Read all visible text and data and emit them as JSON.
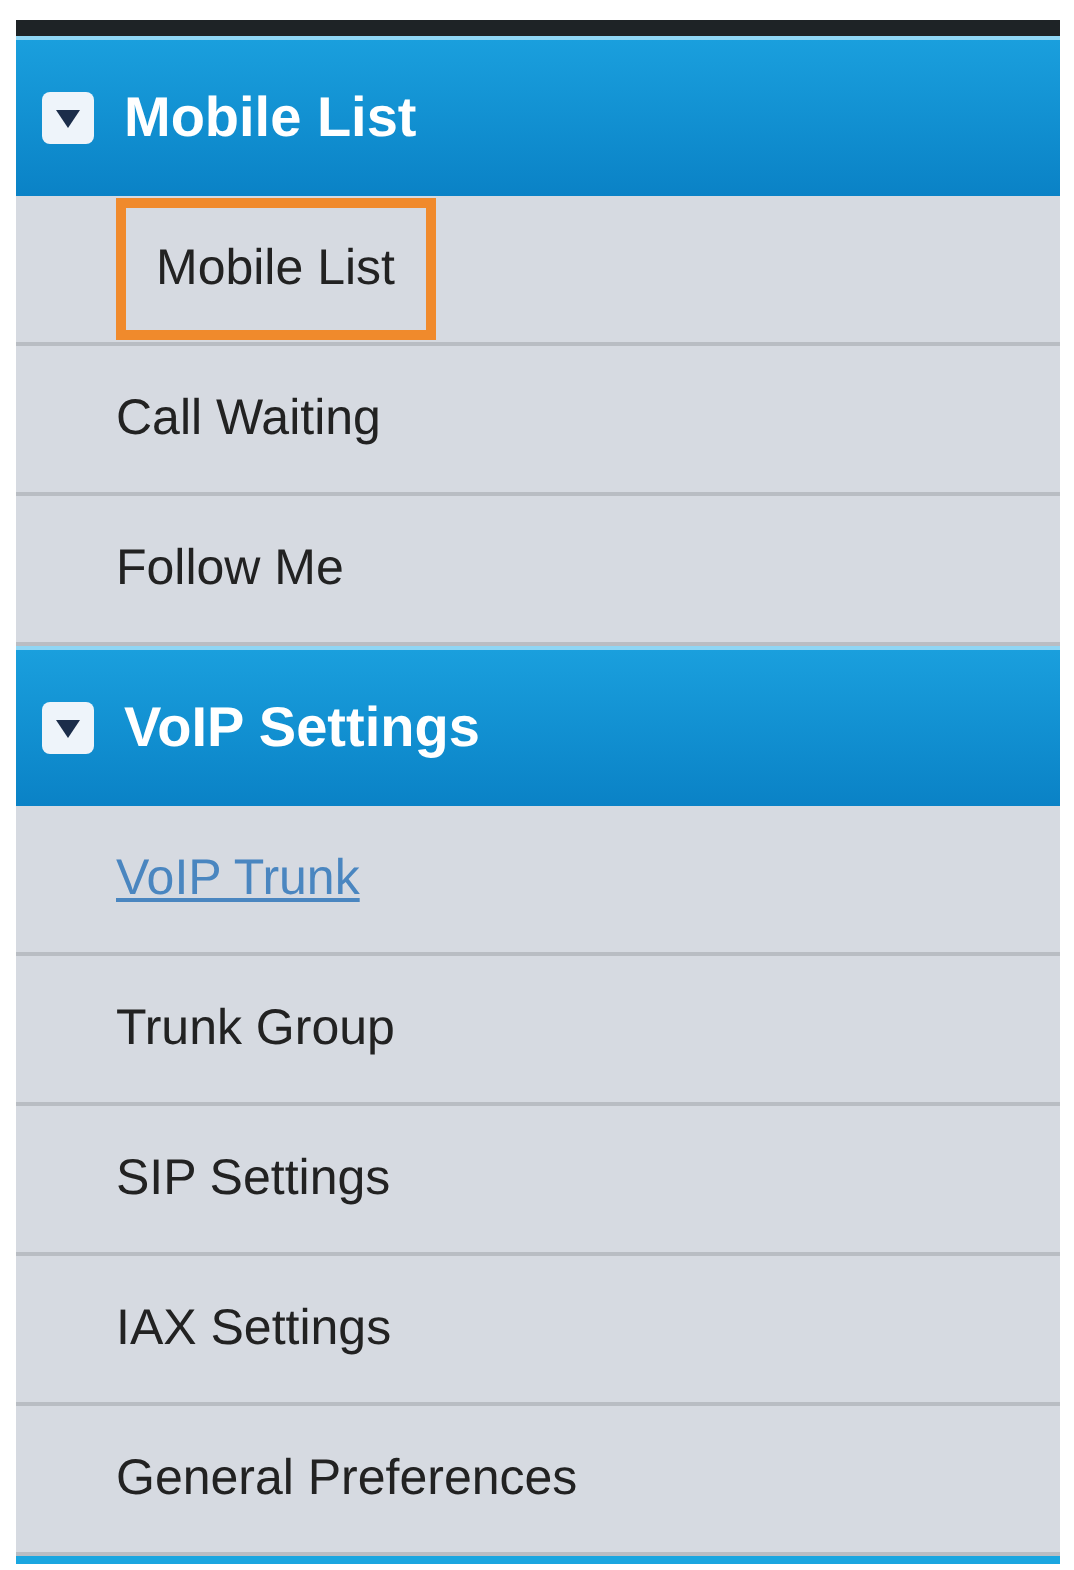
{
  "sections": [
    {
      "title": "Mobile List",
      "expanded": true,
      "items": [
        {
          "label": "Mobile List",
          "kind": "outlined"
        },
        {
          "label": "Call Waiting",
          "kind": "plain"
        },
        {
          "label": "Follow Me",
          "kind": "plain"
        }
      ]
    },
    {
      "title": "VoIP Settings",
      "expanded": true,
      "items": [
        {
          "label": "VoIP Trunk",
          "kind": "link"
        },
        {
          "label": "Trunk Group",
          "kind": "plain"
        },
        {
          "label": "SIP Settings",
          "kind": "plain"
        },
        {
          "label": "IAX Settings",
          "kind": "plain"
        },
        {
          "label": "General Preferences",
          "kind": "plain"
        }
      ]
    }
  ]
}
